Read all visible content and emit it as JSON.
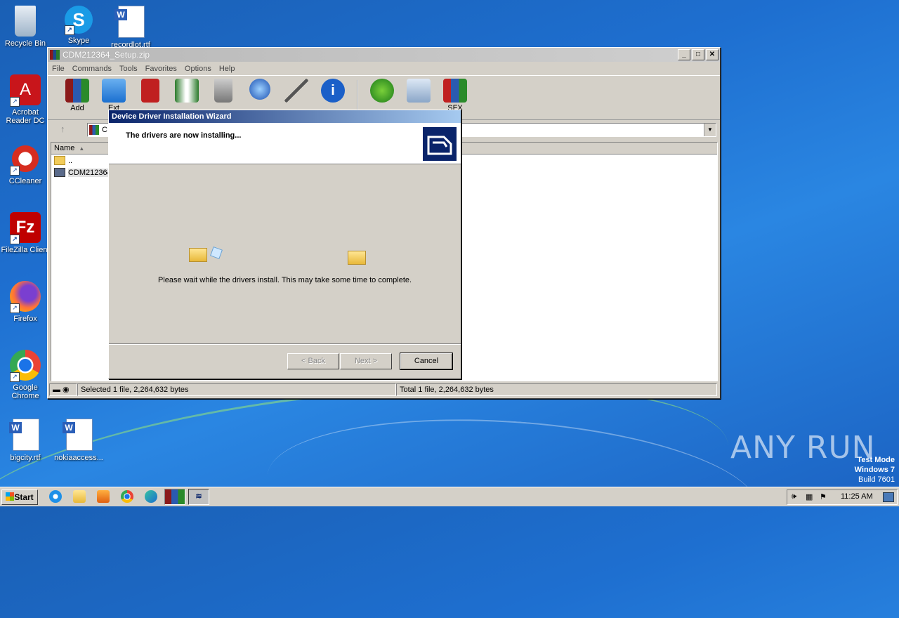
{
  "desktop": {
    "icons": [
      {
        "label": "Recycle Bin"
      },
      {
        "label": "Skype"
      },
      {
        "label": "recordlot.rtf"
      },
      {
        "label": "Acrobat Reader DC"
      },
      {
        "label": "CCleaner"
      },
      {
        "label": "FileZilla Client"
      },
      {
        "label": "Firefox"
      },
      {
        "label": "Google Chrome"
      },
      {
        "label": "bigcity.rtf"
      },
      {
        "label": "nokiaaccess..."
      }
    ],
    "watermark": "ANY RUN",
    "testmode": {
      "line1": "Test Mode",
      "line2": "Windows 7",
      "line3": "Build 7601"
    }
  },
  "winrar": {
    "title": "CDM212364_Setup.zip",
    "menu": [
      "File",
      "Commands",
      "Tools",
      "Favorites",
      "Options",
      "Help"
    ],
    "toolbar": {
      "add": "Add",
      "extract": "Ext",
      "sfx": "SFX"
    },
    "address": "C",
    "column_name": "Name",
    "rows": [
      {
        "name": ".."
      },
      {
        "name": "CDM212364_"
      }
    ],
    "status_left": "Selected 1 file, 2,264,632 bytes",
    "status_right": "Total 1 file, 2,264,632 bytes"
  },
  "wizard": {
    "title": "Device Driver Installation Wizard",
    "heading": "The drivers are now installing...",
    "message": "Please wait while the drivers install. This may take some time to complete.",
    "back": "< Back",
    "next": "Next >",
    "cancel": "Cancel"
  },
  "taskbar": {
    "start": "Start",
    "clock": "11:25 AM"
  },
  "colors": {
    "desktop": "#1e6fd0",
    "wizard_title": "#0a246a"
  }
}
